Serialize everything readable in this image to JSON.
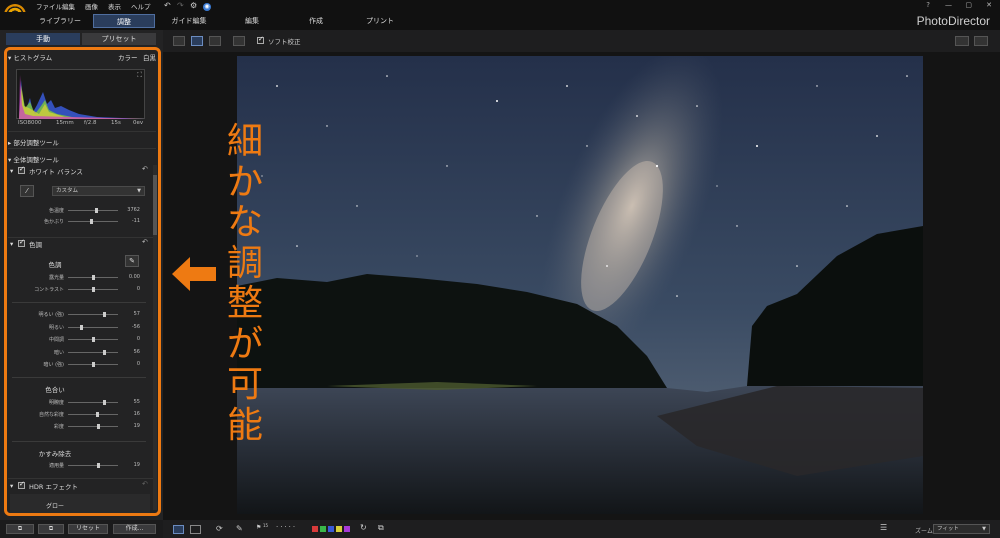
{
  "menu": [
    "ファイル",
    "編集",
    "画像",
    "表示",
    "ヘルプ"
  ],
  "main_tabs": [
    "ライブラリー",
    "調整",
    "ガイド編集",
    "編集",
    "作成",
    "プリント"
  ],
  "active_tab": "調整",
  "brand": "PhotoDirector",
  "window_help": "?",
  "sub_tabs": [
    "手動",
    "プリセット"
  ],
  "histogram": {
    "title": "ヒストグラム",
    "mode_color": "カラー",
    "mode_bw": "白黒",
    "info": [
      "ISO8000",
      "15mm",
      "f/2.8",
      "15s",
      "0ev"
    ]
  },
  "sections": {
    "local": "部分調整ツール",
    "global": "全体調整ツール"
  },
  "white_balance": {
    "title": "ホワイト バランス",
    "preset": "カスタム",
    "sliders": [
      {
        "label": "色温度",
        "value": "3762",
        "pos": 0.55
      },
      {
        "label": "色かぶり",
        "value": "-11",
        "pos": 0.45
      }
    ]
  },
  "tone": {
    "title": "色調",
    "group_tone": "色調",
    "sliders1": [
      {
        "label": "露光量",
        "value": "0.00",
        "pos": 0.5
      },
      {
        "label": "コントラスト",
        "value": "0",
        "pos": 0.5
      }
    ],
    "sliders2": [
      {
        "label": "明るい (強)",
        "value": "57",
        "pos": 0.72
      },
      {
        "label": "明るい",
        "value": "-56",
        "pos": 0.25
      },
      {
        "label": "中間調",
        "value": "0",
        "pos": 0.5
      },
      {
        "label": "暗い",
        "value": "56",
        "pos": 0.72
      },
      {
        "label": "暗い (強)",
        "value": "0",
        "pos": 0.5
      }
    ],
    "group_color": "色合い",
    "sliders3": [
      {
        "label": "明瞭度",
        "value": "55",
        "pos": 0.72
      },
      {
        "label": "自然な彩度",
        "value": "16",
        "pos": 0.58
      },
      {
        "label": "彩度",
        "value": "19",
        "pos": 0.6
      }
    ],
    "group_haze": "かすみ除去",
    "sliders4": [
      {
        "label": "適用量",
        "value": "19",
        "pos": 0.6
      }
    ]
  },
  "hdr": {
    "title": "HDR エフェクト",
    "glow": "グロー"
  },
  "bottom_buttons": [
    "リセット",
    "作成..."
  ],
  "viewer": {
    "soft_proof": "ソフト校正",
    "zoom_label": "ズーム:",
    "zoom_value": "フィット",
    "flag_count": "15"
  },
  "annotation": "細かな調整が可能",
  "colors": {
    "accent_orange": "#ee7a12",
    "active_tab_bg": "#2a3d5c"
  },
  "icons": [
    "undo-icon",
    "redo-icon",
    "settings-icon",
    "help-icon",
    "zoom-icon",
    "hand-icon",
    "eyedropper-icon",
    "reset-icon"
  ]
}
